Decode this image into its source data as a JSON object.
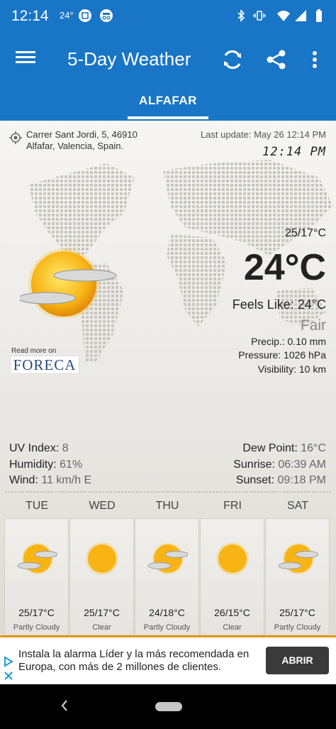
{
  "status_bar": {
    "time": "12:14",
    "temp": "24°",
    "icons": [
      "screenshot-icon",
      "incognito-icon",
      "bluetooth-icon",
      "vibrate-icon",
      "wifi-icon",
      "signal-icon",
      "battery-icon"
    ]
  },
  "app_bar": {
    "title": "5-Day Weather",
    "tab_label": "ALFAFAR",
    "brand_color": "#1975c6"
  },
  "location": {
    "address_line1": "Carrer Sant Jordi, 5, 46910",
    "address_line2": "Alfafar, Valencia, Spain.",
    "last_update": "Last update: May 26  12:14 PM",
    "clock": "12:14 PM"
  },
  "current": {
    "hilo": "25/17°C",
    "temp": "24°C",
    "feels_like": "Feels Like: 24°C",
    "condition": "Fair",
    "precip": "Precip.: 0.10 mm",
    "pressure": "Pressure: 1026 hPa",
    "visibility": "Visibility: 10 km",
    "icon": "sun-partly-cloudy-icon"
  },
  "attribution": {
    "read_more": "Read more on",
    "brand": "FORECA"
  },
  "details": {
    "uv_label": "UV Index:",
    "uv_value": "8",
    "humidity_label": "Humidity:",
    "humidity_value": "61%",
    "wind_label": "Wind:",
    "wind_value": "11 km/h E",
    "dew_label": "Dew Point:",
    "dew_value": "16°C",
    "sunrise_label": "Sunrise:",
    "sunrise_value": "06:39 AM",
    "sunset_label": "Sunset:",
    "sunset_value": "09:18 PM"
  },
  "forecast": [
    {
      "day": "TUE",
      "temp": "25/17°C",
      "condition": "Partly Cloudy",
      "icon": "partly-cloudy-icon"
    },
    {
      "day": "WED",
      "temp": "25/17°C",
      "condition": "Clear",
      "icon": "sun-icon"
    },
    {
      "day": "THU",
      "temp": "24/18°C",
      "condition": "Partly Cloudy",
      "icon": "partly-cloudy-icon"
    },
    {
      "day": "FRI",
      "temp": "26/15°C",
      "condition": "Clear",
      "icon": "sun-icon"
    },
    {
      "day": "SAT",
      "temp": "25/17°C",
      "condition": "Partly Cloudy",
      "icon": "partly-cloudy-icon"
    }
  ],
  "ad": {
    "text": "Instala la alarma Líder y la más recomendada en Europa, con más de 2 millones de clientes.",
    "button": "ABRIR"
  }
}
